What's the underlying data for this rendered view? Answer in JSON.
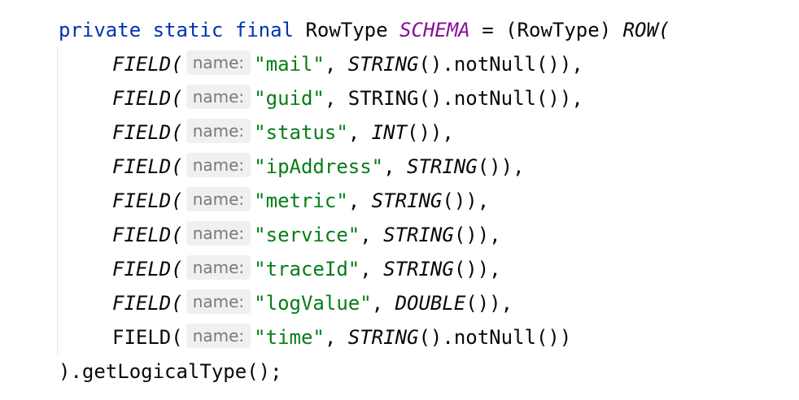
{
  "code": {
    "decl": {
      "modifiers": "private static final",
      "type": "RowType",
      "name": "SCHEMA",
      "eq": " = ",
      "cast": "(RowType)",
      "call": "ROW",
      "paren": "("
    },
    "param_hint": "name:",
    "fields": [
      {
        "fn": "FIELD",
        "name": "\"mail\"",
        "type_fn": "STRING",
        "type_italic": true,
        "rest": "().notNull()),"
      },
      {
        "fn": "FIELD",
        "name": "\"guid\"",
        "type_fn": "STRING",
        "type_italic": false,
        "rest": "().notNull()),"
      },
      {
        "fn": "FIELD",
        "name": "\"status\"",
        "type_fn": "INT",
        "type_italic": true,
        "rest": "()),"
      },
      {
        "fn": "FIELD",
        "name": "\"ipAddress\"",
        "type_fn": "STRING",
        "type_italic": true,
        "rest": "()),"
      },
      {
        "fn": "FIELD",
        "name": "\"metric\"",
        "type_fn": "STRING",
        "type_italic": true,
        "rest": "()),"
      },
      {
        "fn": "FIELD",
        "name": "\"service\"",
        "type_fn": "STRING",
        "type_italic": true,
        "rest": "()),"
      },
      {
        "fn": "FIELD",
        "name": "\"traceId\"",
        "type_fn": "STRING",
        "type_italic": true,
        "rest": "()),"
      },
      {
        "fn": "FIELD",
        "name": "\"logValue\"",
        "type_fn": "DOUBLE",
        "type_italic": true,
        "rest": "()),"
      },
      {
        "fn": "FIELD",
        "name": "\"time\"",
        "type_fn": "STRING",
        "type_italic": true,
        "rest": "().notNull())",
        "fn_plain": true
      }
    ],
    "closing": ").getLogicalType();"
  },
  "colors": {
    "keyword": "#0033b3",
    "static_field": "#871094",
    "string": "#067d17",
    "hint_bg": "#f0f0f0",
    "hint_text": "#7a7a7a"
  }
}
